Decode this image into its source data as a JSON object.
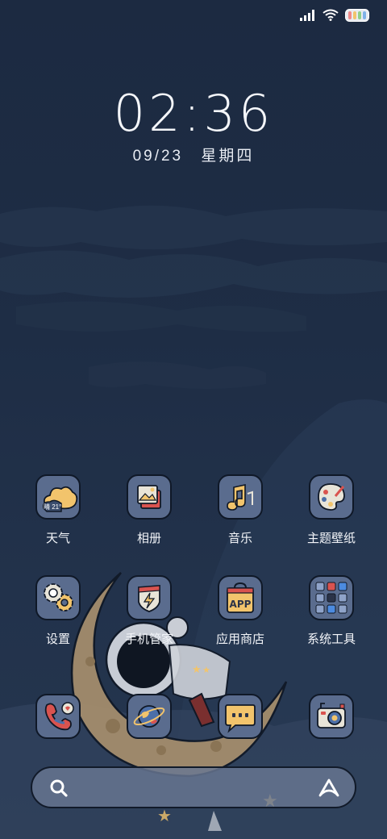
{
  "status_bar": {
    "signal_icon": "signal-icon",
    "wifi_icon": "wifi-icon",
    "battery_icon": "battery-icon"
  },
  "clock": {
    "time": "02:36",
    "date": "09/23",
    "weekday": "星期四"
  },
  "apps": [
    {
      "label": "天气",
      "icon": "weather-icon",
      "weather_text": "晴 21°"
    },
    {
      "label": "相册",
      "icon": "gallery-icon"
    },
    {
      "label": "音乐",
      "icon": "music-icon"
    },
    {
      "label": "主题壁纸",
      "icon": "theme-icon"
    },
    {
      "label": "设置",
      "icon": "settings-icon"
    },
    {
      "label": "手机管家",
      "icon": "security-icon"
    },
    {
      "label": "应用商店",
      "icon": "app-store-icon",
      "badge_text": "APP"
    },
    {
      "label": "系统工具",
      "icon": "folder-icon"
    }
  ],
  "dock": [
    {
      "icon": "phone-icon"
    },
    {
      "icon": "browser-icon"
    },
    {
      "icon": "messages-icon"
    },
    {
      "icon": "camera-icon"
    }
  ],
  "search": {
    "search_icon": "search-icon",
    "voice_icon": "assistant-icon"
  },
  "colors": {
    "background": "#1e2d45",
    "icon_tile": "#5a6c8e",
    "accent_yellow": "#f2c46c",
    "accent_red": "#d9534f"
  }
}
